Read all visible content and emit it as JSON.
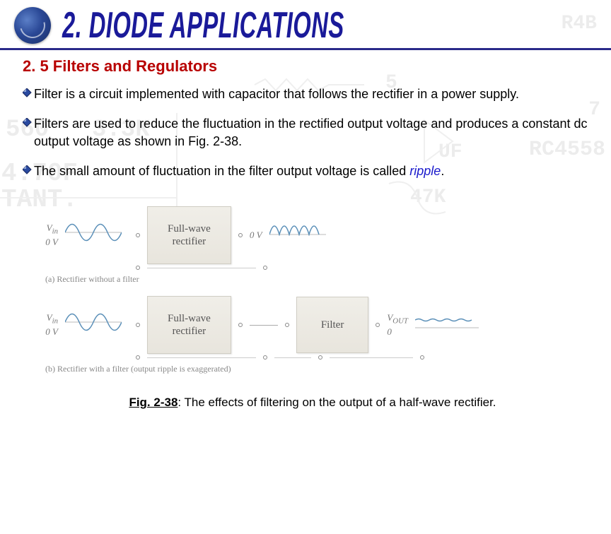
{
  "header": {
    "title": "2. DIODE APPLICATIONS"
  },
  "section": {
    "heading": "2. 5   Filters and Regulators",
    "bullets": [
      {
        "text": "Filter is a circuit implemented with capacitor that follows the rectifier in a power supply."
      },
      {
        "text": "Filters are used to reduce the fluctuation in the rectified output voltage and produces a constant dc output voltage as shown in Fig. 2-38."
      },
      {
        "text_prefix": "The small amount of fluctuation in the filter output voltage is called ",
        "keyword": "ripple",
        "text_suffix": "."
      }
    ]
  },
  "figure": {
    "vin_label": "V",
    "vin_sub": "in",
    "zero_label": "0 V",
    "vout_label": "V",
    "vout_sub": "OUT",
    "zero_right": "0",
    "block_rectifier": "Full-wave rectifier",
    "block_filter": "Filter",
    "sub_a": "(a) Rectifier without a filter",
    "sub_b": "(b) Rectifier with a filter (output ripple is exaggerated)",
    "caption_num": "Fig. 2-38",
    "caption_text": ": The effects of filtering on the output of a half-wave rectifier."
  },
  "bg_labels": [
    "R4B",
    "5",
    "7",
    "560",
    "3.3K",
    "UF",
    "4.70F",
    "TANT.",
    "47K",
    "RC4558"
  ]
}
